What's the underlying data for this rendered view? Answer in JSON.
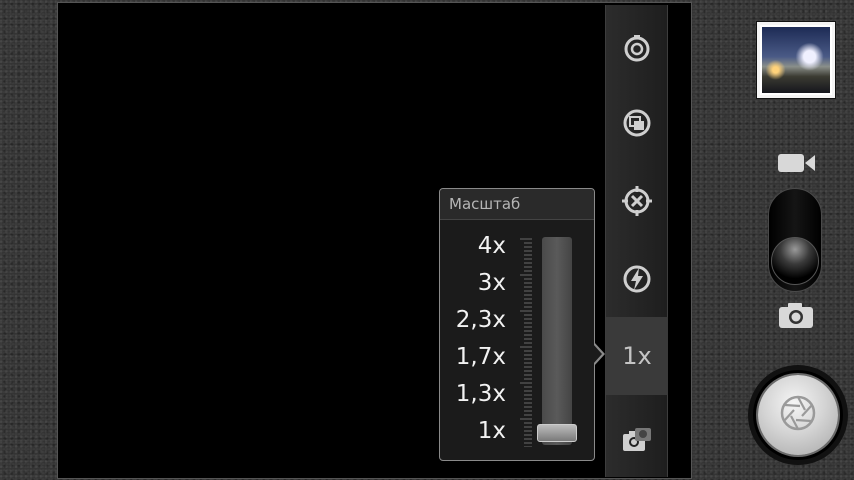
{
  "camera": {
    "viewfinder": {
      "state": "black"
    },
    "settings_strip": {
      "items": [
        {
          "icon": "camera-settings-icon"
        },
        {
          "icon": "scene-mode-icon"
        },
        {
          "icon": "focus-mode-icon"
        },
        {
          "icon": "flash-off-icon"
        },
        {
          "icon": "zoom-level",
          "label": "1x"
        },
        {
          "icon": "switch-camera-icon"
        }
      ]
    },
    "zoom_popup": {
      "title": "Масштаб",
      "levels": [
        "4x",
        "3x",
        "2,3x",
        "1,7x",
        "1,3x",
        "1x"
      ],
      "current_level": "1x",
      "slider_value": 0
    },
    "right_panel": {
      "thumbnail_icon": "last-photo-thumbnail",
      "video_mode_icon": "video-camera-icon",
      "photo_mode_icon": "photo-camera-icon",
      "mode_switch_selected": "photo",
      "shutter_icon": "shutter-aperture-icon"
    },
    "colors": {
      "background": "#333333",
      "viewfinder": "#000000",
      "popup_border": "#8a8a8a",
      "text": "#f2f2f2"
    }
  }
}
